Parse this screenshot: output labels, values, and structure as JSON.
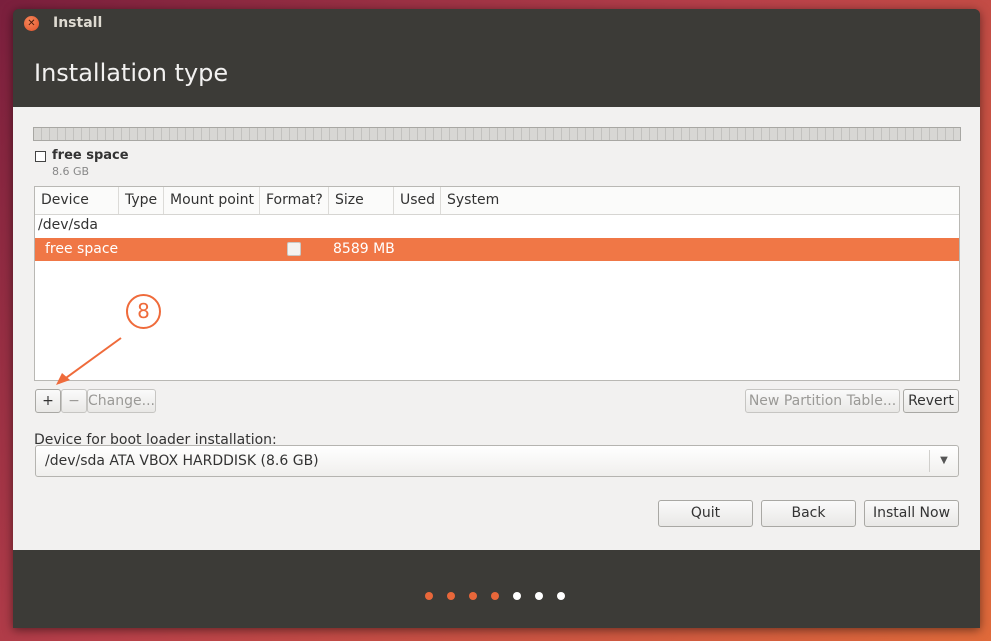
{
  "window": {
    "title": "Install"
  },
  "page": {
    "title": "Installation type"
  },
  "legend": {
    "label": "free space",
    "size": "8.6 GB"
  },
  "table": {
    "columns": [
      "Device",
      "Type",
      "Mount point",
      "Format?",
      "Size",
      "Used",
      "System"
    ],
    "device": "/dev/sda",
    "selected_row": {
      "device": "free space",
      "size": "8589 MB"
    }
  },
  "annotation": {
    "number": "8"
  },
  "partition_buttons": {
    "add": "+",
    "remove": "−",
    "change": "Change..."
  },
  "table_buttons": {
    "new_table": "New Partition Table...",
    "revert": "Revert"
  },
  "bootloader": {
    "label": "Device for boot loader installation:",
    "value": "/dev/sda  ATA VBOX HARDDISK (8.6 GB)"
  },
  "actions": {
    "quit": "Quit",
    "back": "Back",
    "install_now": "Install Now"
  },
  "progress": {
    "total_steps": 7,
    "completed_steps": 4
  },
  "colors": {
    "accent": "#f07746",
    "dot_done": "#e8673a",
    "dot_todo": "#ffffff"
  }
}
